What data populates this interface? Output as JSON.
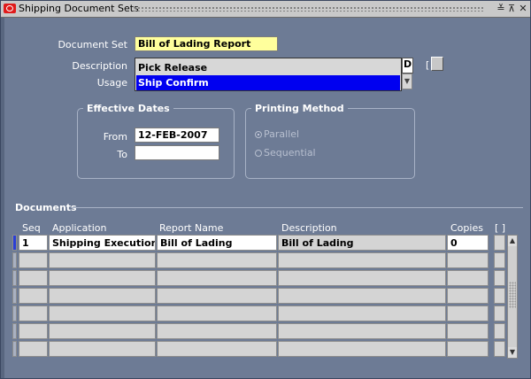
{
  "window": {
    "title": "Shipping Document Sets",
    "controls": [
      "≚",
      "⊼",
      "✕"
    ]
  },
  "header": {
    "document_set_label": "Document Set",
    "document_set_value": "Bill of Lading Report",
    "description_label": "Description",
    "usage_label": "Usage",
    "description_dropdown": {
      "options": [
        "Pick Release",
        "Ship Confirm"
      ],
      "selected": "Ship Confirm"
    },
    "d_box_value": "D",
    "bracket_label": "[ ]"
  },
  "effective_dates": {
    "title": "Effective Dates",
    "from_label": "From",
    "from_value": "12-FEB-2007",
    "to_label": "To",
    "to_value": ""
  },
  "printing_method": {
    "title": "Printing Method",
    "options": [
      "Parallel",
      "Sequential"
    ],
    "selected": "Parallel"
  },
  "documents": {
    "title": "Documents",
    "columns": [
      "Seq",
      "Application",
      "Report Name",
      "Description",
      "Copies",
      "[ ]"
    ],
    "rows": [
      {
        "seq": "1",
        "application": "Shipping Execution",
        "report_name": "Bill of Lading",
        "description": "Bill of Lading",
        "copies": "0"
      }
    ],
    "empty_rows": 6
  },
  "colors": {
    "canvas": "#6d7b95",
    "required_field": "#ffff9c",
    "selected": "#0000f0"
  }
}
